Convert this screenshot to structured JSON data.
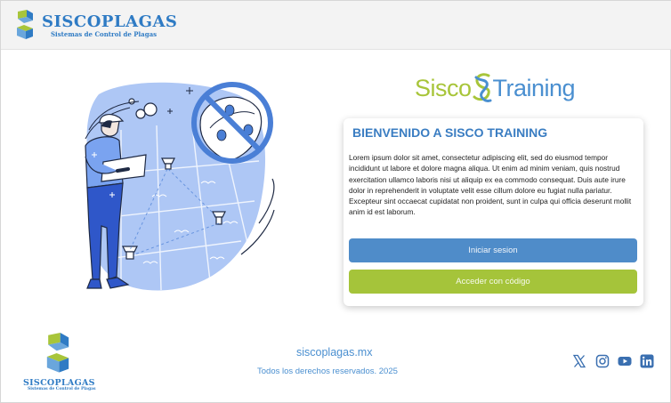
{
  "header": {
    "brand_name": "SISCOPLAGAS",
    "brand_tagline": "Sistemas de Control de Plagas"
  },
  "training_logo": {
    "left_word": "Sisco",
    "right_word": "Training"
  },
  "welcome_card": {
    "title": "BIENVENIDO A SISCO TRAINING",
    "body": "Lorem ipsum dolor sit amet, consectetur adipiscing elit, sed do eiusmod tempor incididunt ut labore et dolore magna aliqua. Ut enim ad minim  veniam, quis nostrud exercitation ullamco laboris nisi ut aliquip ex ea  commodo consequat. Duis aute irure dolor in reprehenderit in voluptate  velit esse cillum dolore eu fugiat nulla pariatur. Excepteur sint  occaecat cupidatat non proident, sunt in culpa qui officia deserunt  mollit anim id est laborum.",
    "login_button": "Iniciar sesion",
    "code_button": "Acceder con código"
  },
  "footer": {
    "brand_name": "SISCOPLAGAS",
    "brand_tagline": "Sistemas de Control de Plagas",
    "website": "siscoplagas.mx",
    "copyright": "Todos los derechos reservados. 2025",
    "social_icons": [
      "x-icon",
      "instagram-icon",
      "youtube-icon",
      "linkedin-icon"
    ]
  },
  "colors": {
    "brand_blue": "#2f7bc4",
    "accent_blue": "#4f8cc9",
    "accent_green": "#a5c43a"
  }
}
